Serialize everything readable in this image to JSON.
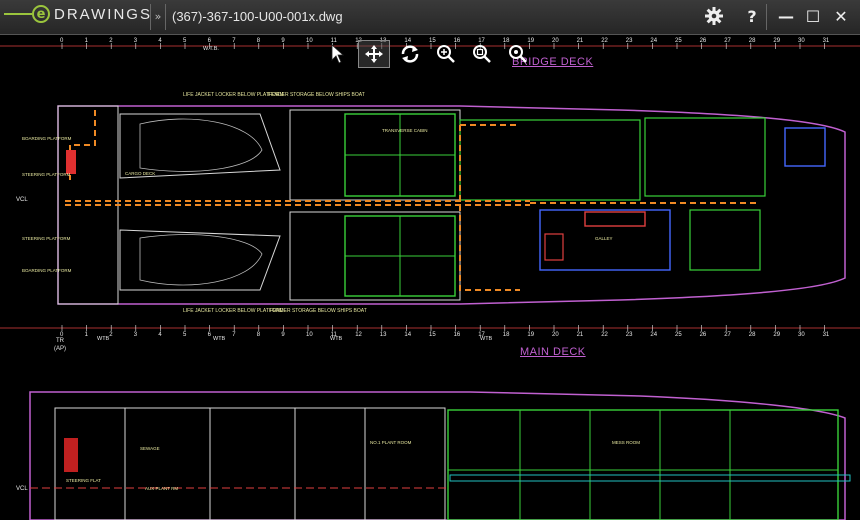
{
  "app": {
    "brand": "DRAWINGS",
    "brand_mark": "e",
    "file_name": "(367)-367-100-U00-001x.dwg"
  },
  "toolbar": {
    "expand_glyph": "»",
    "settings_icon": "gear-icon",
    "help_label": "?",
    "minimize_label": "—",
    "maximize_label": "☐",
    "close_label": "✕"
  },
  "view_tools": [
    {
      "name": "select-tool",
      "icon": "arrow-cursor-icon"
    },
    {
      "name": "pan-tool",
      "icon": "move-arrows-icon",
      "active": true
    },
    {
      "name": "rotate-tool",
      "icon": "rotate-icon"
    },
    {
      "name": "zoom-tool",
      "icon": "zoom-icon"
    },
    {
      "name": "zoom-area-tool",
      "icon": "zoom-area-icon"
    },
    {
      "name": "zoom-fit-tool",
      "icon": "zoom-fit-icon"
    }
  ],
  "drawing": {
    "deck_labels": {
      "upper": "BRIDGE DECK",
      "lower": "MAIN DECK"
    },
    "frame_numbers": [
      "0",
      "1",
      "2",
      "3",
      "4",
      "5",
      "6",
      "7",
      "8",
      "9",
      "10",
      "11",
      "12",
      "13",
      "14",
      "15",
      "16",
      "17",
      "18",
      "19",
      "20",
      "21",
      "22",
      "23",
      "24",
      "25",
      "26",
      "27",
      "28",
      "29",
      "30",
      "31"
    ],
    "wtb_label": "WTB",
    "wtb_top": "W.T.B.",
    "tr_label": "TR",
    "ap_label": "(AP)",
    "vcl_label": "VCL",
    "room_labels": {
      "lifejacket_top": "LIFE JACKET LOCKER BELOW PLATFORM",
      "fender_top": "FENDER STORAGE BELOW SHIPS BOAT",
      "lifejacket_bot": "LIFE JACKET LOCKER BELOW PLATFORM",
      "fender_bot": "FENDER STORAGE BELOW SHIPS BOAT",
      "boarding_port": "BOARDING PLATFORM",
      "boarding_stbd": "BOARDING PLATFORM",
      "steering_port": "STEERING PLATFORM",
      "steering_stbd": "STEERING PLATFORM",
      "cargo_deck": "CARGO DECK",
      "galley": "GALLEY",
      "transverse": "TRANSVERSE CABIN",
      "main_steering": "STEERING FLAT",
      "main_sewage": "SEWAGE",
      "main_plant": "AUX PLANT RM",
      "main_no1": "NO.1 PLANT ROOM",
      "main_mess": "MESS ROOM"
    }
  },
  "colors": {
    "background": "#000000",
    "titlebar": "#2e2e2e",
    "accent": "#9bc53d",
    "deck_label": "#c060d0",
    "hull": "#c060d0",
    "wall": "#e0e0e0",
    "cabin": "#3ad13a",
    "route": "#f08a24",
    "grid": "#e04040"
  }
}
